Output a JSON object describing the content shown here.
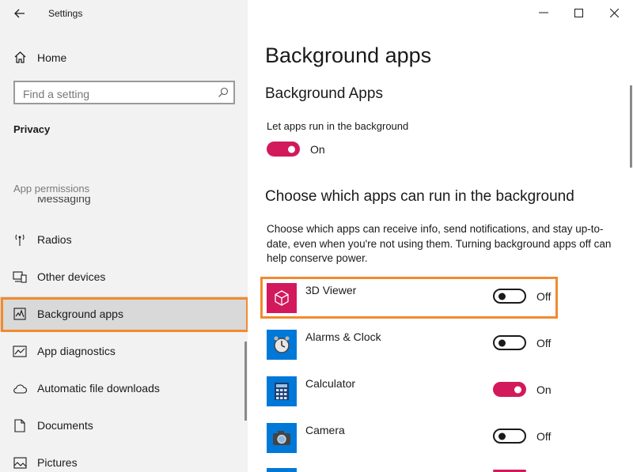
{
  "window": {
    "title": "Settings"
  },
  "sidebar": {
    "home_label": "Home",
    "search_placeholder": "Find a setting",
    "section_title": "Privacy",
    "group_label": "App permissions",
    "peek_item": "Messaging",
    "items": [
      {
        "label": "Radios",
        "icon": "radios-icon"
      },
      {
        "label": "Other devices",
        "icon": "other-devices-icon"
      },
      {
        "label": "Background apps",
        "icon": "background-apps-icon",
        "selected": true
      },
      {
        "label": "App diagnostics",
        "icon": "app-diagnostics-icon"
      },
      {
        "label": "Automatic file downloads",
        "icon": "cloud-icon"
      },
      {
        "label": "Documents",
        "icon": "document-icon"
      },
      {
        "label": "Pictures",
        "icon": "picture-icon"
      }
    ]
  },
  "main": {
    "page_title": "Background apps",
    "section1_title": "Background Apps",
    "let_apps_label": "Let apps run in the background",
    "let_apps_state": "On",
    "section2_title": "Choose which apps can run in the background",
    "description": "Choose which apps can receive info, send notifications, and stay up-to-date, even when you're not using them. Turning background apps off can help conserve power.",
    "apps": [
      {
        "name": "3D Viewer",
        "state": "Off",
        "on": false,
        "tile_color": "#d2195b",
        "icon": "cube-icon"
      },
      {
        "name": "Alarms & Clock",
        "state": "Off",
        "on": false,
        "tile_color": "#0078d7",
        "icon": "clock-icon"
      },
      {
        "name": "Calculator",
        "state": "On",
        "on": true,
        "tile_color": "#0078d7",
        "icon": "calculator-icon"
      },
      {
        "name": "Camera",
        "state": "Off",
        "on": false,
        "tile_color": "#0078d7",
        "icon": "camera-icon"
      }
    ]
  },
  "colors": {
    "accent": "#d2195b",
    "highlight": "#f28a2e",
    "sidebar_bg": "#f2f2f2",
    "selected_bg": "#d9d9d9"
  }
}
